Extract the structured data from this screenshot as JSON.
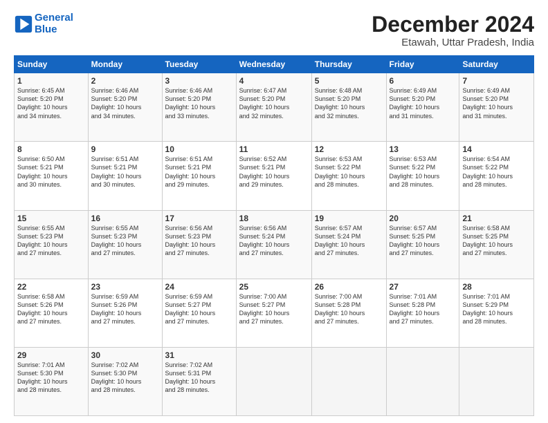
{
  "header": {
    "logo_line1": "General",
    "logo_line2": "Blue",
    "title": "December 2024",
    "subtitle": "Etawah, Uttar Pradesh, India"
  },
  "calendar": {
    "days_of_week": [
      "Sunday",
      "Monday",
      "Tuesday",
      "Wednesday",
      "Thursday",
      "Friday",
      "Saturday"
    ],
    "weeks": [
      [
        {
          "day": "",
          "detail": ""
        },
        {
          "day": "2",
          "detail": "Sunrise: 6:46 AM\nSunset: 5:20 PM\nDaylight: 10 hours\nand 34 minutes."
        },
        {
          "day": "3",
          "detail": "Sunrise: 6:46 AM\nSunset: 5:20 PM\nDaylight: 10 hours\nand 33 minutes."
        },
        {
          "day": "4",
          "detail": "Sunrise: 6:47 AM\nSunset: 5:20 PM\nDaylight: 10 hours\nand 32 minutes."
        },
        {
          "day": "5",
          "detail": "Sunrise: 6:48 AM\nSunset: 5:20 PM\nDaylight: 10 hours\nand 32 minutes."
        },
        {
          "day": "6",
          "detail": "Sunrise: 6:49 AM\nSunset: 5:20 PM\nDaylight: 10 hours\nand 31 minutes."
        },
        {
          "day": "7",
          "detail": "Sunrise: 6:49 AM\nSunset: 5:20 PM\nDaylight: 10 hours\nand 31 minutes."
        }
      ],
      [
        {
          "day": "1",
          "detail": "Sunrise: 6:45 AM\nSunset: 5:20 PM\nDaylight: 10 hours\nand 34 minutes."
        },
        {
          "day": "9",
          "detail": "Sunrise: 6:51 AM\nSunset: 5:21 PM\nDaylight: 10 hours\nand 30 minutes."
        },
        {
          "day": "10",
          "detail": "Sunrise: 6:51 AM\nSunset: 5:21 PM\nDaylight: 10 hours\nand 29 minutes."
        },
        {
          "day": "11",
          "detail": "Sunrise: 6:52 AM\nSunset: 5:21 PM\nDaylight: 10 hours\nand 29 minutes."
        },
        {
          "day": "12",
          "detail": "Sunrise: 6:53 AM\nSunset: 5:22 PM\nDaylight: 10 hours\nand 28 minutes."
        },
        {
          "day": "13",
          "detail": "Sunrise: 6:53 AM\nSunset: 5:22 PM\nDaylight: 10 hours\nand 28 minutes."
        },
        {
          "day": "14",
          "detail": "Sunrise: 6:54 AM\nSunset: 5:22 PM\nDaylight: 10 hours\nand 28 minutes."
        }
      ],
      [
        {
          "day": "8",
          "detail": "Sunrise: 6:50 AM\nSunset: 5:21 PM\nDaylight: 10 hours\nand 30 minutes."
        },
        {
          "day": "16",
          "detail": "Sunrise: 6:55 AM\nSunset: 5:23 PM\nDaylight: 10 hours\nand 27 minutes."
        },
        {
          "day": "17",
          "detail": "Sunrise: 6:56 AM\nSunset: 5:23 PM\nDaylight: 10 hours\nand 27 minutes."
        },
        {
          "day": "18",
          "detail": "Sunrise: 6:56 AM\nSunset: 5:24 PM\nDaylight: 10 hours\nand 27 minutes."
        },
        {
          "day": "19",
          "detail": "Sunrise: 6:57 AM\nSunset: 5:24 PM\nDaylight: 10 hours\nand 27 minutes."
        },
        {
          "day": "20",
          "detail": "Sunrise: 6:57 AM\nSunset: 5:25 PM\nDaylight: 10 hours\nand 27 minutes."
        },
        {
          "day": "21",
          "detail": "Sunrise: 6:58 AM\nSunset: 5:25 PM\nDaylight: 10 hours\nand 27 minutes."
        }
      ],
      [
        {
          "day": "15",
          "detail": "Sunrise: 6:55 AM\nSunset: 5:23 PM\nDaylight: 10 hours\nand 27 minutes."
        },
        {
          "day": "23",
          "detail": "Sunrise: 6:59 AM\nSunset: 5:26 PM\nDaylight: 10 hours\nand 27 minutes."
        },
        {
          "day": "24",
          "detail": "Sunrise: 6:59 AM\nSunset: 5:27 PM\nDaylight: 10 hours\nand 27 minutes."
        },
        {
          "day": "25",
          "detail": "Sunrise: 7:00 AM\nSunset: 5:27 PM\nDaylight: 10 hours\nand 27 minutes."
        },
        {
          "day": "26",
          "detail": "Sunrise: 7:00 AM\nSunset: 5:28 PM\nDaylight: 10 hours\nand 27 minutes."
        },
        {
          "day": "27",
          "detail": "Sunrise: 7:01 AM\nSunset: 5:28 PM\nDaylight: 10 hours\nand 27 minutes."
        },
        {
          "day": "28",
          "detail": "Sunrise: 7:01 AM\nSunset: 5:29 PM\nDaylight: 10 hours\nand 28 minutes."
        }
      ],
      [
        {
          "day": "22",
          "detail": "Sunrise: 6:58 AM\nSunset: 5:26 PM\nDaylight: 10 hours\nand 27 minutes."
        },
        {
          "day": "30",
          "detail": "Sunrise: 7:02 AM\nSunset: 5:30 PM\nDaylight: 10 hours\nand 28 minutes."
        },
        {
          "day": "31",
          "detail": "Sunrise: 7:02 AM\nSunset: 5:31 PM\nDaylight: 10 hours\nand 28 minutes."
        },
        {
          "day": "",
          "detail": ""
        },
        {
          "day": "",
          "detail": ""
        },
        {
          "day": "",
          "detail": ""
        },
        {
          "day": "",
          "detail": ""
        }
      ],
      [
        {
          "day": "29",
          "detail": "Sunrise: 7:01 AM\nSunset: 5:30 PM\nDaylight: 10 hours\nand 28 minutes."
        },
        {
          "day": "",
          "detail": ""
        },
        {
          "day": "",
          "detail": ""
        },
        {
          "day": "",
          "detail": ""
        },
        {
          "day": "",
          "detail": ""
        },
        {
          "day": "",
          "detail": ""
        },
        {
          "day": "",
          "detail": ""
        }
      ]
    ]
  }
}
